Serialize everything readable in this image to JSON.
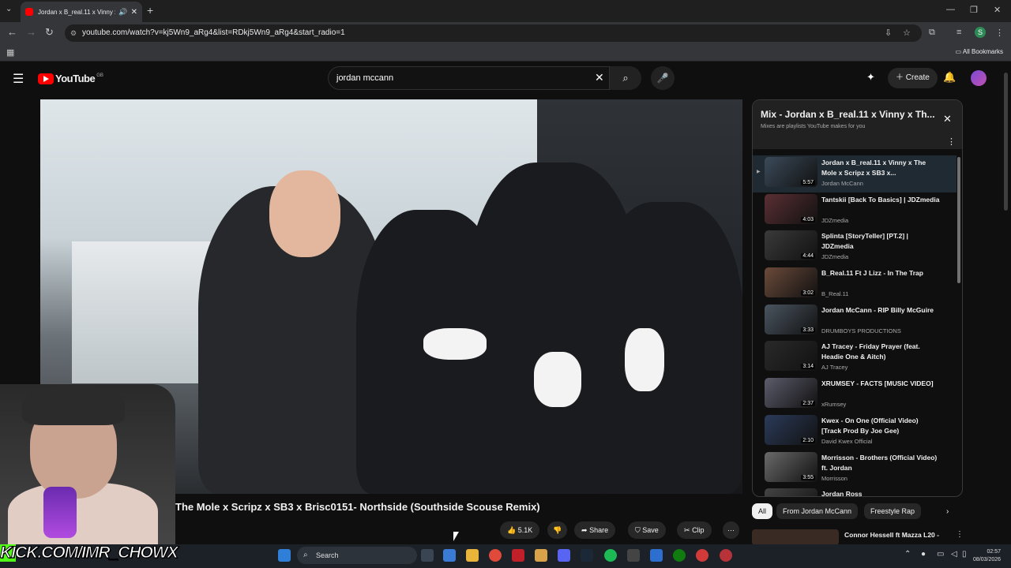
{
  "browser": {
    "tab_title": "Jordan x B_real.11 x Vinny x",
    "url": "youtube.com/watch?v=kj5Wn9_aRg4&list=RDkj5Wn9_aRg4&start_radio=1",
    "bookmarks_label": "All Bookmarks",
    "profile_initial": "S"
  },
  "youtube": {
    "logo_text": "YouTube",
    "region": "GB",
    "search_value": "jordan mccann",
    "create_label": "Create"
  },
  "video": {
    "title": "The Mole x Scripz x SB3 x Brisc0151- Northside (Southside Scouse Remix)",
    "like_count": "5.1K",
    "share_label": "Share",
    "save_label": "Save",
    "clip_label": "Clip"
  },
  "playlist": {
    "title": "Mix - Jordan x B_real.11 x Vinny x Th...",
    "subtitle": "Mixes are playlists YouTube makes for you",
    "items": [
      {
        "title": "Jordan x B_real.11 x Vinny x The Mole x Scripz x SB3 x...",
        "channel": "Jordan McCann",
        "duration": "5:57",
        "color": "#3b4a5a"
      },
      {
        "title": "Tantskii [Back To Basics] | JDZmedia",
        "channel": "JDZmedia",
        "duration": "4:03",
        "color": "#5a2f33"
      },
      {
        "title": "Splinta [StoryTeller] [PT.2] | JDZmedia",
        "channel": "JDZmedia",
        "duration": "4:44",
        "color": "#3a3a3a"
      },
      {
        "title": "B_Real.11 Ft J Lizz - In The Trap",
        "channel": "B_Real.11",
        "duration": "3:02",
        "color": "#6b4a3a"
      },
      {
        "title": "Jordan McCann - RIP Billy McGuire",
        "channel": "DRUMBOYS PRODUCTIONS",
        "duration": "3:33",
        "color": "#4a5560"
      },
      {
        "title": "AJ Tracey - Friday Prayer (feat. Headie One & Aitch)",
        "channel": "AJ Tracey",
        "duration": "3:14",
        "color": "#2a2a2a"
      },
      {
        "title": "XRUMSEY - FACTS [MUSIC VIDEO]",
        "channel": "xRumsey",
        "duration": "2:37",
        "color": "#5c5c6c"
      },
      {
        "title": "Kwex - On One (Official Video) [Track Prod By Joe Gee)",
        "channel": "David Kwex Official",
        "duration": "2:10",
        "color": "#2c3b5a"
      },
      {
        "title": "Morrisson - Brothers (Official Video) ft. Jordan",
        "channel": "Morrisson",
        "duration": "3:55",
        "color": "#6a6a6a"
      },
      {
        "title": "Jordan Ross",
        "channel": "",
        "duration": "",
        "color": "#444"
      }
    ]
  },
  "chips": [
    "All",
    "From Jordan McCann",
    "Freestyle Rap"
  ],
  "recommendation": {
    "title": "Connor Hessell ft Mazza L20 -"
  },
  "overlay": {
    "kick_text": "KICK.COM/IMR_CHOWX"
  },
  "taskbar": {
    "search_label": "Search",
    "time": "02:57",
    "date": "08/03/2026"
  }
}
